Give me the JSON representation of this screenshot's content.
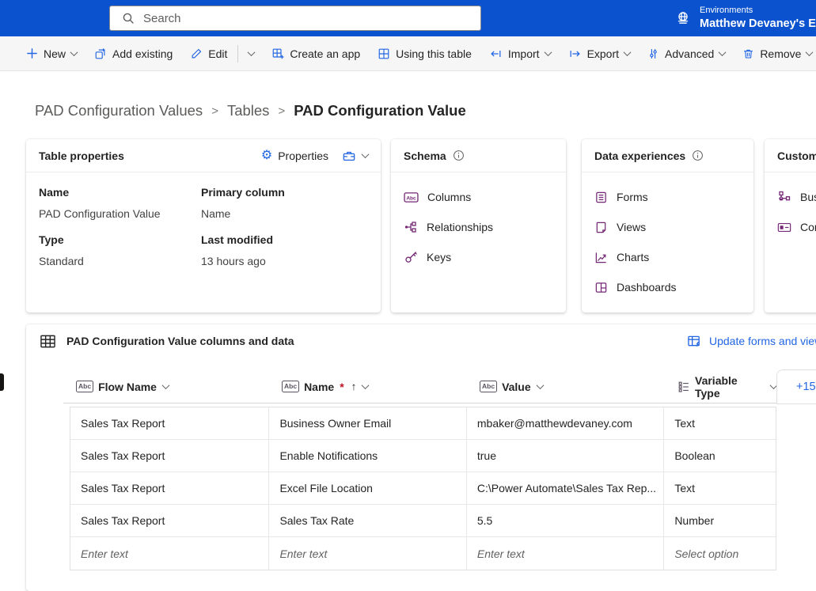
{
  "colors": {
    "brand": "#0B53CE",
    "accent": "#2266E3",
    "purple": "#742774"
  },
  "topbar": {
    "search_placeholder": "Search",
    "environments_label": "Environments",
    "environment_name": "Matthew Devaney's E"
  },
  "command_bar": {
    "items": [
      {
        "label": "New"
      },
      {
        "label": "Add existing"
      },
      {
        "label": "Edit"
      },
      {
        "label": "Create an app"
      },
      {
        "label": "Using this table"
      },
      {
        "label": "Import"
      },
      {
        "label": "Export"
      },
      {
        "label": "Advanced"
      },
      {
        "label": "Remove"
      }
    ]
  },
  "breadcrumb": {
    "separator": ">",
    "items": [
      {
        "label": "PAD Configuration Values"
      },
      {
        "label": "Tables"
      },
      {
        "label": "PAD Configuration Value"
      }
    ]
  },
  "cards": {
    "table_properties": {
      "title": "Table properties",
      "properties_button": "Properties",
      "fields": [
        {
          "label": "Name",
          "value": "PAD Configuration Value"
        },
        {
          "label": "Primary column",
          "value": "Name"
        },
        {
          "label": "Type",
          "value": "Standard"
        },
        {
          "label": "Last modified",
          "value": "13 hours ago"
        }
      ]
    },
    "schema": {
      "title": "Schema",
      "items": [
        {
          "label": "Columns"
        },
        {
          "label": "Relationships"
        },
        {
          "label": "Keys"
        }
      ]
    },
    "data_experiences": {
      "title": "Data experiences",
      "items": [
        {
          "label": "Forms"
        },
        {
          "label": "Views"
        },
        {
          "label": "Charts"
        },
        {
          "label": "Dashboards"
        }
      ]
    },
    "customizations": {
      "title": "Custom",
      "items": [
        {
          "label": "Bus"
        },
        {
          "label": "Con"
        }
      ]
    }
  },
  "grid": {
    "section_title": "PAD Configuration Value columns and data",
    "update_link": "Update forms and view",
    "more_columns_label": "+15",
    "type_icon_text": "Abc",
    "columns": [
      {
        "label": "Flow Name"
      },
      {
        "label": "Name",
        "required_marker": "*",
        "sort_indicator": "↑"
      },
      {
        "label": "Value"
      },
      {
        "label": "Variable Type"
      }
    ],
    "rows": [
      {
        "flow_name": "Sales Tax Report",
        "name": "Business Owner Email",
        "value": "mbaker@matthewdevaney.com",
        "variable_type": "Text"
      },
      {
        "flow_name": "Sales Tax Report",
        "name": "Enable Notifications",
        "value": "true",
        "variable_type": "Boolean"
      },
      {
        "flow_name": "Sales Tax Report",
        "name": "Excel File Location",
        "value": "C:\\Power Automate\\Sales Tax Rep...",
        "variable_type": "Text"
      },
      {
        "flow_name": "Sales Tax Report",
        "name": "Sales Tax Rate",
        "value": "5.5",
        "variable_type": "Number"
      }
    ],
    "new_row": {
      "flow_name": "Enter text",
      "name": "Enter text",
      "value": "Enter text",
      "variable_type": "Select option"
    }
  }
}
